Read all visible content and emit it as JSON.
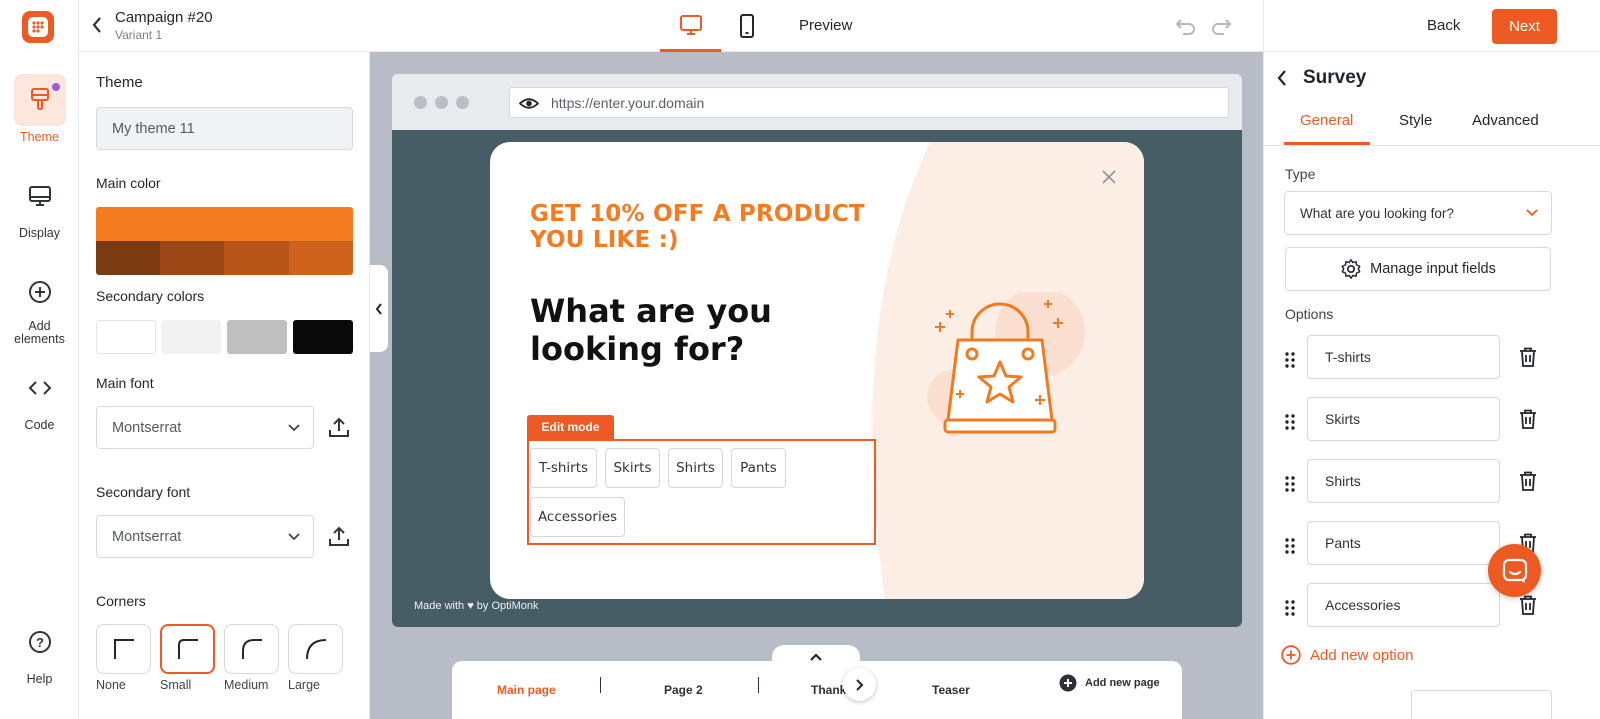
{
  "header": {
    "campaign_title": "Campaign #20",
    "variant": "Variant 1",
    "preview_label": "Preview",
    "back_label": "Back",
    "next_label": "Next"
  },
  "rail": {
    "items": [
      {
        "label": "Theme"
      },
      {
        "label": "Display"
      },
      {
        "label": "Add elements"
      },
      {
        "label": "Code"
      },
      {
        "label": "Help"
      }
    ]
  },
  "theme_panel": {
    "heading": "Theme",
    "theme_name": "My theme 11",
    "main_color_label": "Main color",
    "main_color": "#f47b20",
    "main_shades": [
      "#7a3a12",
      "#9c4716",
      "#b8561a",
      "#cf621d"
    ],
    "secondary_colors_label": "Secondary colors",
    "secondary_colors": [
      "#ffffff",
      "#f2f2f2",
      "#bfbfbf",
      "#0a0a0a"
    ],
    "main_font_label": "Main font",
    "main_font_value": "Montserrat",
    "secondary_font_label": "Secondary font",
    "secondary_font_value": "Montserrat",
    "corners_label": "Corners",
    "corners": [
      {
        "label": "None"
      },
      {
        "label": "Small"
      },
      {
        "label": "Medium"
      },
      {
        "label": "Large"
      }
    ]
  },
  "canvas": {
    "url": "https://enter.your.domain",
    "popup": {
      "headline": "GET 10% OFF A PRODUCT YOU LIKE :)",
      "question": "What are you looking for?",
      "edit_mode_label": "Edit mode",
      "options": [
        "T-shirts",
        "Skirts",
        "Shirts",
        "Pants",
        "Accessories"
      ]
    },
    "footer": "Made with ♥ by OptiMonk"
  },
  "pages": {
    "tabs": [
      "Main page",
      "Page 2",
      "Thank",
      "Teaser"
    ],
    "add_label": "Add new page"
  },
  "right_panel": {
    "title": "Survey",
    "tabs": [
      "General",
      "Style",
      "Advanced"
    ],
    "type_label": "Type",
    "type_value": "What are you looking for?",
    "manage_label": "Manage input fields",
    "options_label": "Options",
    "options": [
      "T-shirts",
      "Skirts",
      "Shirts",
      "Pants",
      "Accessories"
    ],
    "add_option_label": "Add new option"
  },
  "colors": {
    "accent": "#ed5a24"
  }
}
